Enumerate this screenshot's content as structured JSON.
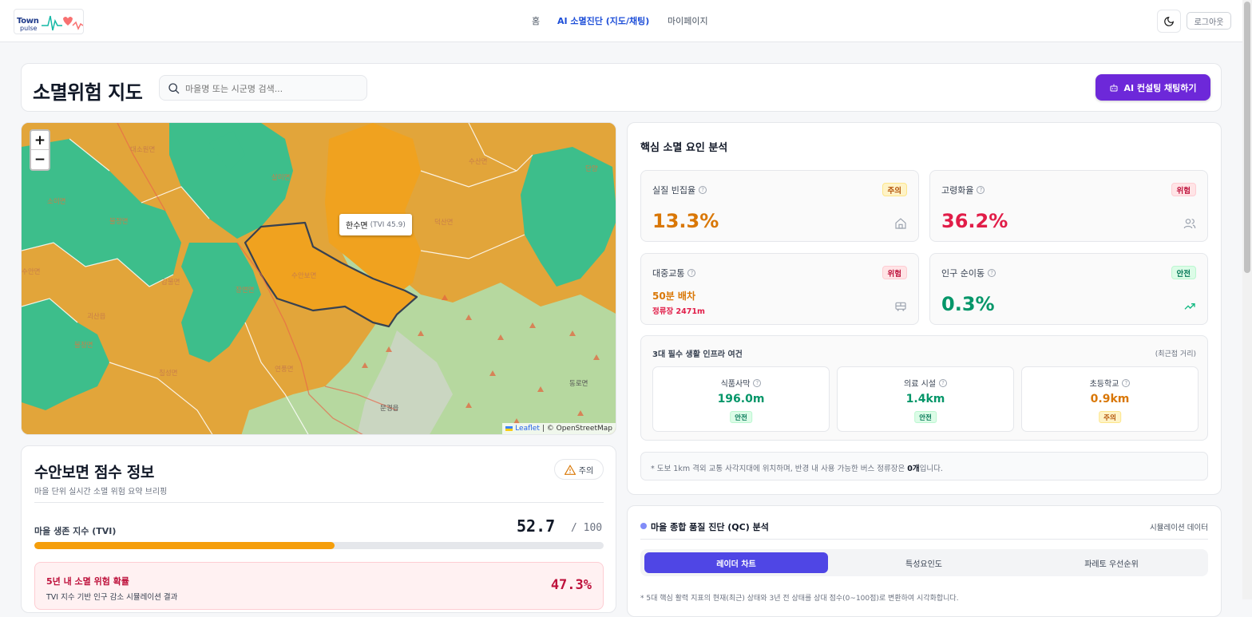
{
  "logo": {
    "line1": "Town",
    "line2": "pulse"
  },
  "nav": {
    "home": "홈",
    "ai": "AI 소멸진단 (지도/채팅)",
    "mypage": "마이페이지"
  },
  "auth": {
    "logout": "로그아웃"
  },
  "header": {
    "title": "소멸위험 지도",
    "search_placeholder": "마을명 또는 시군명 검색...",
    "ai_button": "AI 컨설팅 채팅하기"
  },
  "map": {
    "zoom_in": "+",
    "zoom_out": "−",
    "tooltip_name": "한수면",
    "tooltip_tvi": "(TVI 45.9)",
    "attribution_leaflet": "Leaflet",
    "attribution_osm": "| © OpenStreetMap",
    "place_labels": [
      "대소원면",
      "살미면",
      "소이면",
      "불정면",
      "수안보면",
      "감물면",
      "장연면",
      "괴산읍",
      "칠성면",
      "연풍면",
      "문경읍",
      "덕산면",
      "수산면",
      "단양",
      "동로면",
      "불정면"
    ],
    "colors": {
      "high_risk": "#e2a53a",
      "mid_risk": "#f0a21f",
      "safe": "#3dbe8b",
      "forest": "#b5d99c"
    }
  },
  "score": {
    "title": "수안보면 점수 정보",
    "subtitle": "마을 단위 실시간 소멸 위험 요약 브리핑",
    "status": "주의",
    "tvi_label": "마을 생존 지수 (TVI)",
    "tvi_value": "52.7",
    "tvi_max": "/ 100",
    "tvi_fraction": 0.527,
    "risk_title": "5년 내 소멸 위험 확률",
    "risk_sub": "TVI 지수 기반 인구 감소 시뮬레이션 결과",
    "risk_value": "47.3%"
  },
  "factors": {
    "title": "핵심 소멸 요인 분석",
    "vacancy": {
      "label": "실질 빈집율",
      "badge": "주의",
      "value": "13.3%"
    },
    "aging": {
      "label": "고령화율",
      "badge": "위험",
      "value": "36.2%"
    },
    "transit": {
      "label": "대중교통",
      "badge": "위험",
      "interval": "50분 배차",
      "distance": "정류장 2471m"
    },
    "migration": {
      "label": "인구 순이동",
      "badge": "안전",
      "value": "0.3%"
    },
    "infra": {
      "title": "3대 필수 생활 인프라 여건",
      "note": "(최근접 거리)",
      "items": [
        {
          "label": "식품사막",
          "value": "196.0m",
          "badge": "안전"
        },
        {
          "label": "의료 시설",
          "value": "1.4km",
          "badge": "안전"
        },
        {
          "label": "초등학교",
          "value": "0.9km",
          "badge": "주의"
        }
      ]
    },
    "footnote_pre": "* 도보 1km 격외 교통 사각지대에 위치하며, 반경 내 사용 가능한 버스 정류장은 ",
    "footnote_count": "0개",
    "footnote_post": "입니다."
  },
  "qc": {
    "title": "마을 종합 품질 진단 (QC) 분석",
    "note": "시뮬레이션 데이터",
    "tabs": [
      "레이더 차트",
      "특성요인도",
      "파레토 우선순위"
    ],
    "footnote": "* 5대 핵심 활력 지표의 현재(최근) 상태와 3년 전 상태를 상대 점수(0~100점)로 변환하여 시각화합니다."
  }
}
